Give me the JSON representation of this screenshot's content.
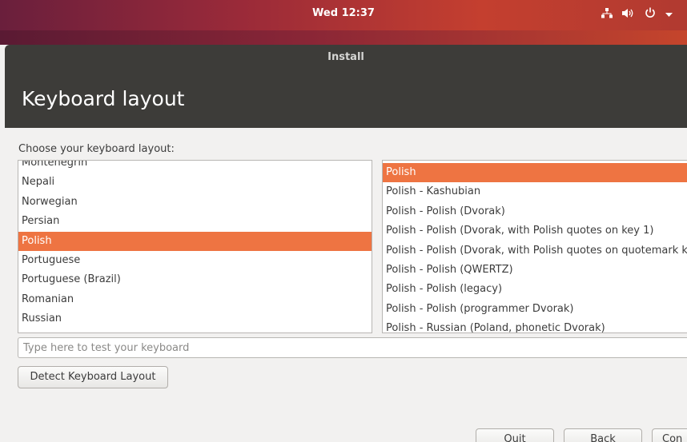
{
  "top_panel": {
    "clock": "Wed 12:37",
    "tray_icons": [
      "network-icon",
      "volume-icon",
      "power-icon",
      "chevron-down-icon"
    ]
  },
  "window": {
    "title": "Install",
    "heading": "Keyboard layout"
  },
  "prompt": "Choose your keyboard layout:",
  "layouts": {
    "items": [
      "Montenegrin",
      "Nepali",
      "Norwegian",
      "Persian",
      "Polish",
      "Portuguese",
      "Portuguese (Brazil)",
      "Romanian",
      "Russian"
    ],
    "selected": "Polish"
  },
  "variants": {
    "items": [
      "Polish",
      "Polish - Kashubian",
      "Polish - Polish (Dvorak)",
      "Polish - Polish (Dvorak, with Polish quotes on key 1)",
      "Polish - Polish (Dvorak, with Polish quotes on quotemark key)",
      "Polish - Polish (QWERTZ)",
      "Polish - Polish (legacy)",
      "Polish - Polish (programmer Dvorak)",
      "Polish - Russian (Poland, phonetic Dvorak)"
    ],
    "selected": "Polish"
  },
  "test_input": {
    "placeholder": "Type here to test your keyboard",
    "value": ""
  },
  "buttons": {
    "detect": "Detect Keyboard Layout",
    "quit": "Quit",
    "back": "Back",
    "continue": "Con"
  },
  "colors": {
    "accent": "#ee7442",
    "header": "#3d3c39"
  }
}
